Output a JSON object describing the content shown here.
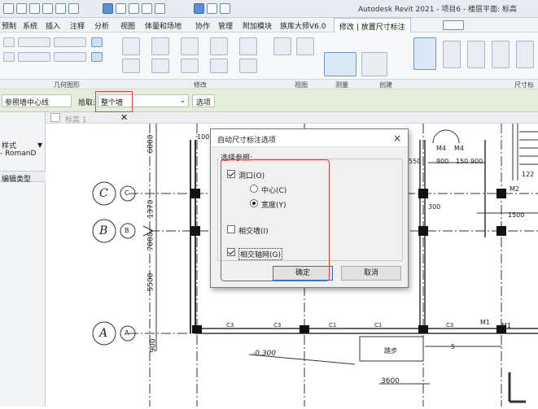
{
  "app_title": "Autodesk Revit 2021 - 项目6 - 楼层平面: 标高",
  "menus": [
    "预制",
    "系统",
    "插入",
    "注释",
    "分析",
    "视图",
    "体量和场地",
    "协作",
    "管理",
    "附加模块",
    "族库大师V6.0",
    "修改 | 放置尺寸标注"
  ],
  "ribbon_groups": [
    "几何图形",
    "修改",
    "视图",
    "测量",
    "创建",
    "尺寸标"
  ],
  "options_bar": {
    "ref_select": "参照墙中心线",
    "pick_label": "拾取:",
    "pick_value": "整个墙",
    "options_button": "选项"
  },
  "view_tab": "标高 1",
  "left_panel": {
    "style_line1": "样式",
    "style_line2": "- RomanD",
    "edit_type": "编辑类型"
  },
  "dialog": {
    "title": "自动尺寸标注选项",
    "close": "×",
    "group_label": "选择参照:",
    "opening": "洞口(O)",
    "center": "中心(C)",
    "width": "宽度(Y)",
    "intersecting_walls": "相交墙(I)",
    "intersecting_grids": "相交轴网(G)",
    "ok": "确定",
    "cancel": "取消",
    "state": {
      "opening": true,
      "center": false,
      "width": true,
      "intersecting_walls": false,
      "intersecting_grids": true
    }
  },
  "drawing": {
    "grid_labels": [
      "C",
      "B",
      "A"
    ],
    "grid_labels_small": [
      "C",
      "B",
      "A"
    ],
    "dims_left": [
      "6000",
      "1370",
      "7000",
      "5500",
      "900"
    ],
    "top_dims": [
      "100",
      "550",
      "900",
      "150",
      "900",
      "300",
      "1500",
      "122"
    ],
    "door_tags": [
      "M4",
      "M4",
      "M2",
      "M1",
      "M1"
    ],
    "window_tags": [
      "C3",
      "C3",
      "C1",
      "C1",
      "C3"
    ],
    "level_text": "-0.300",
    "dim_bottom": "3600",
    "step_text": "踏步",
    "slope_text": "5"
  },
  "colors": {
    "accent_red": "#e04040",
    "dialog_ok_border": "#2a6fd6",
    "options_bar_bg": "#e4efd9"
  }
}
